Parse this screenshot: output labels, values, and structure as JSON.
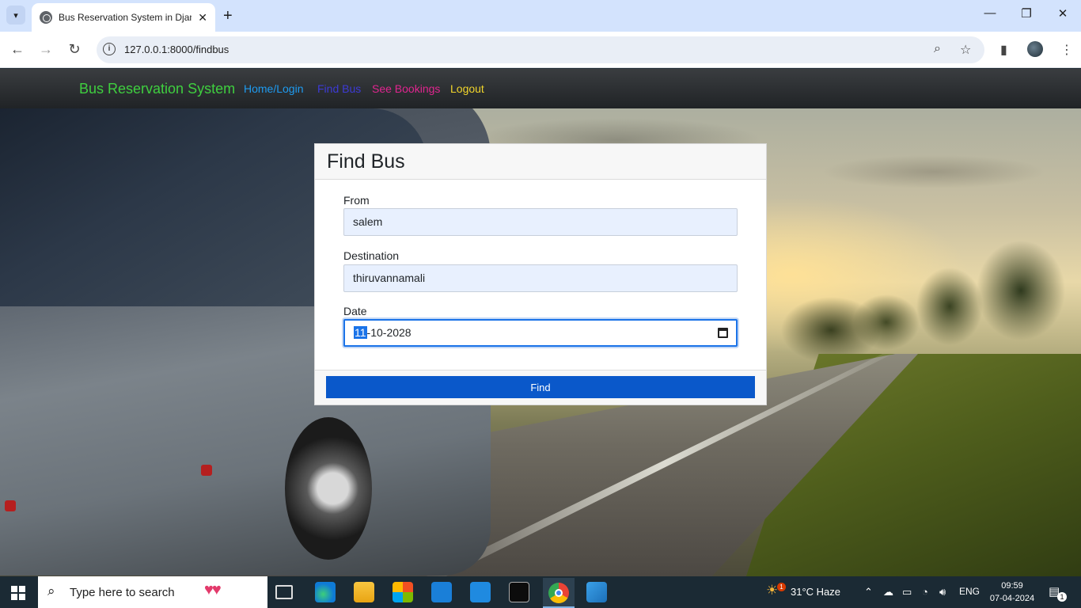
{
  "browser": {
    "tab_title": "Bus Reservation System in Djan",
    "url": "127.0.0.1:8000/findbus",
    "window_controls": {
      "minimize": "—",
      "restore": "❐",
      "close": "✕"
    }
  },
  "site": {
    "brand": "Bus Reservation System",
    "nav": [
      {
        "label": "Home/Login",
        "color": "#1e9bf0"
      },
      {
        "label": "Find Bus",
        "color": "#3d3bd6"
      },
      {
        "label": "See Bookings",
        "color": "#e0258f"
      },
      {
        "label": "Logout",
        "color": "#f1d52b"
      }
    ]
  },
  "form": {
    "title": "Find Bus",
    "from_label": "From",
    "from_value": "salem",
    "destination_label": "Destination",
    "destination_value": "thiruvannamali",
    "date_label": "Date",
    "date_day": "11",
    "date_rest": "-10-2028",
    "submit_label": "Find"
  },
  "taskbar": {
    "search_placeholder": "Type here to search",
    "weather": "31°C  Haze",
    "weather_badge": "1",
    "language": "ENG",
    "time": "09:59",
    "date": "07-04-2024",
    "notifications": "1"
  }
}
